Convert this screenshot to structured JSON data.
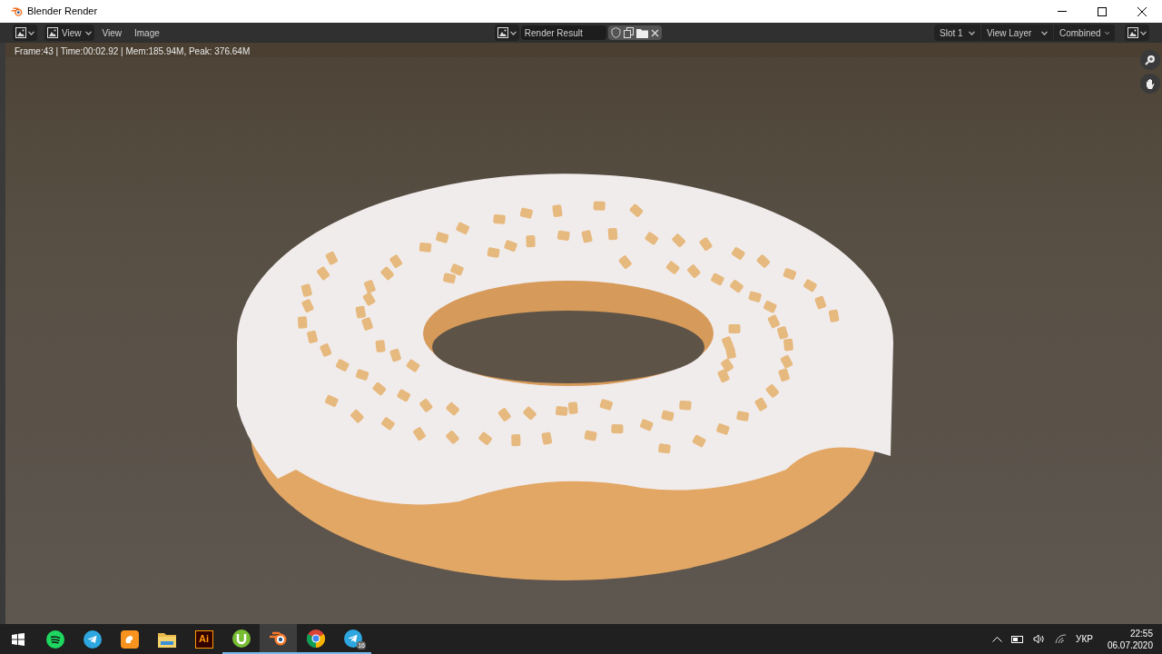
{
  "window": {
    "title": "Blender Render"
  },
  "header": {
    "menus": [
      {
        "label": "View",
        "kind": "dropdown"
      },
      {
        "label": "View",
        "kind": "menu"
      },
      {
        "label": "Image",
        "kind": "menu"
      }
    ],
    "image_name": "Render Result",
    "selectors": [
      "Slot 1",
      "View Layer",
      "Combined"
    ]
  },
  "render_info": "Frame:43 | Time:00:02.92 | Mem:185.94M, Peak: 376.64M",
  "taskbar": {
    "apps": [
      {
        "kind": "spotify",
        "running": false,
        "active": false
      },
      {
        "kind": "telegram",
        "running": false,
        "active": false
      },
      {
        "kind": "browser",
        "running": false,
        "active": false
      },
      {
        "kind": "folder",
        "running": false,
        "active": false
      },
      {
        "kind": "illustrator",
        "label": "Ai",
        "running": false,
        "active": false
      },
      {
        "kind": "torrent",
        "running": true,
        "active": false
      },
      {
        "kind": "blender",
        "running": true,
        "active": true
      },
      {
        "kind": "chrome",
        "running": true,
        "active": false
      },
      {
        "kind": "telegram",
        "badge": "16",
        "running": true,
        "active": false
      }
    ],
    "language": "УКР",
    "time": "22:55",
    "date": "06.07.2020"
  }
}
